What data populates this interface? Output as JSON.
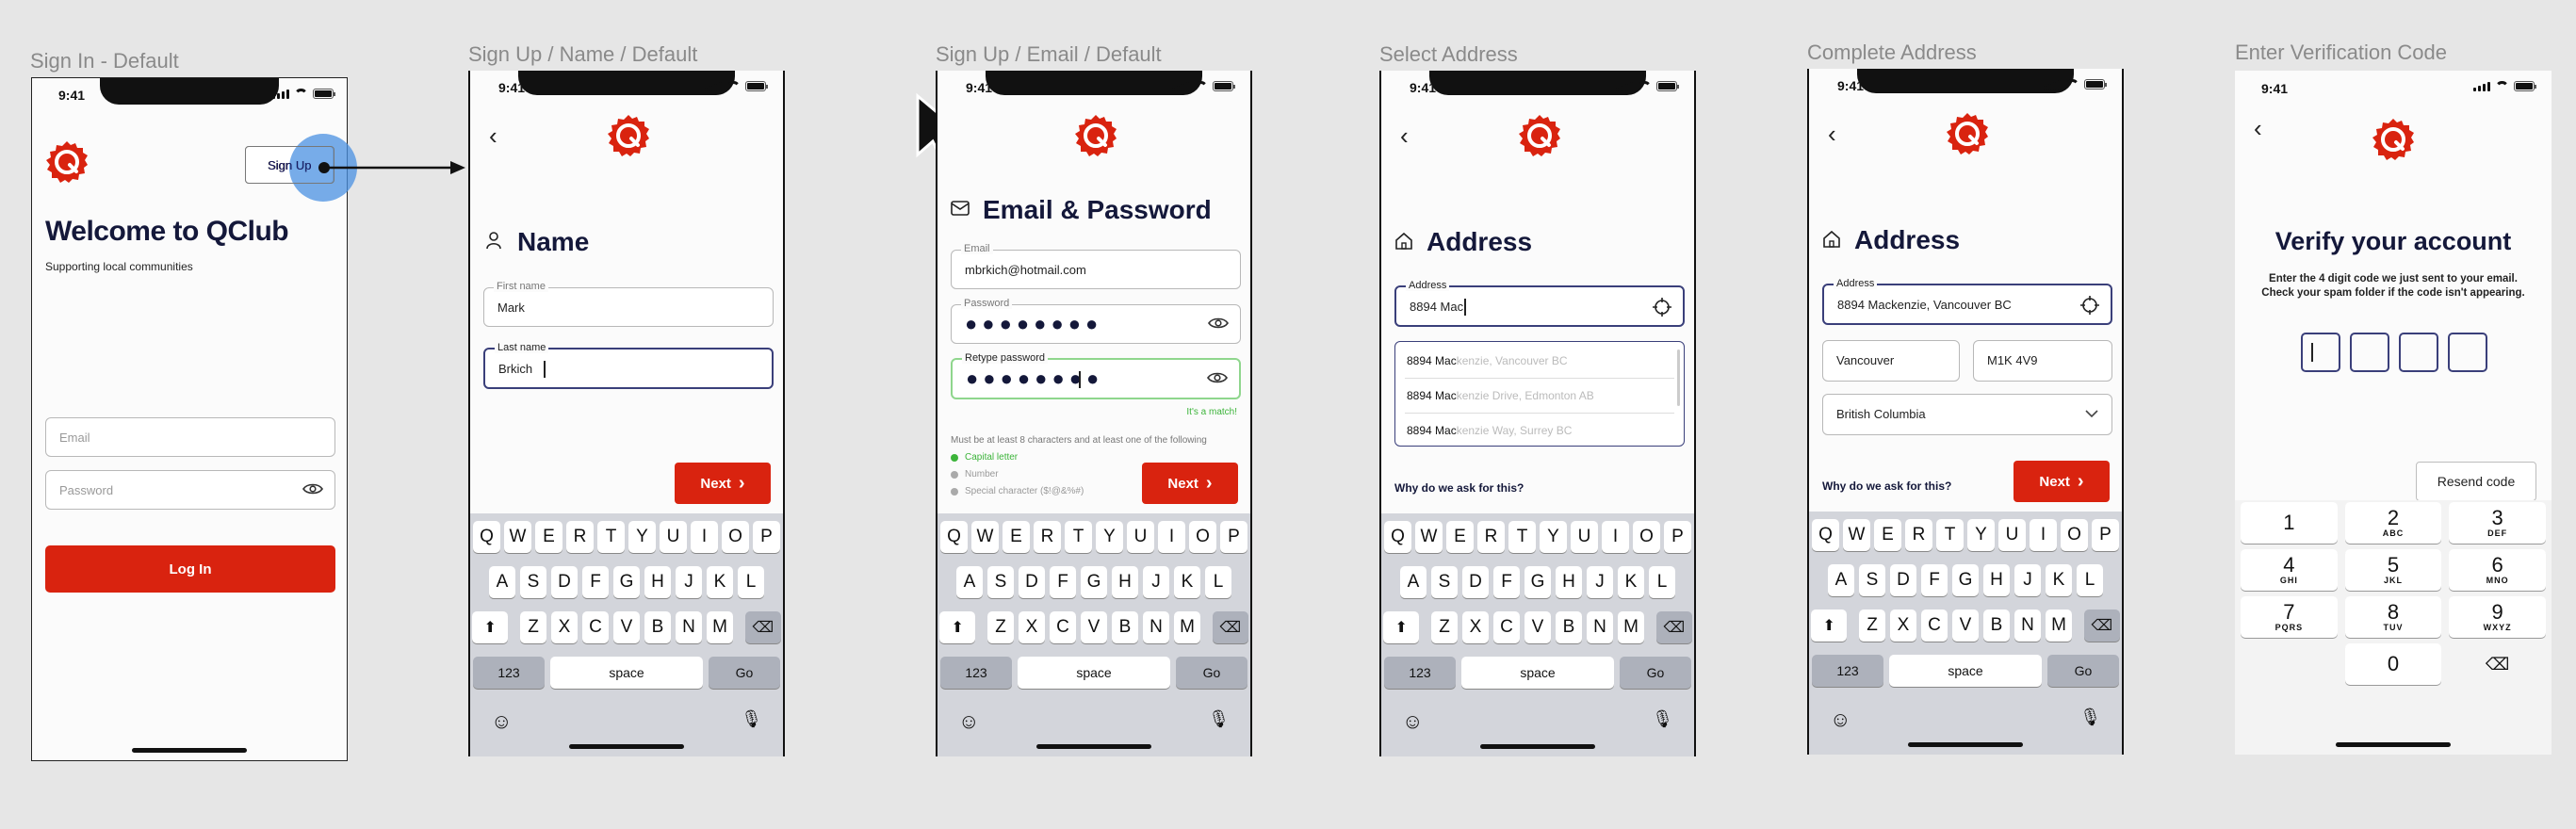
{
  "status_time": "9:41",
  "frames": {
    "f1": {
      "label": "Sign In - Default",
      "welcome": "Welcome to QClub",
      "subtitle": "Supporting local communities",
      "signup": "Sign Up",
      "email_ph": "Email",
      "password_ph": "Password",
      "login": "Log In"
    },
    "f2": {
      "label": "Sign Up / Name / Default",
      "title": "Name",
      "first_label": "First name",
      "first_value": "Mark",
      "last_label": "Last name",
      "last_value": "Brkich",
      "next": "Next"
    },
    "f3": {
      "label": "Sign Up / Email / Default",
      "title": "Email & Password",
      "email_label": "Email",
      "email_value": "mbrkich@hotmail.com",
      "password_label": "Password",
      "retype_label": "Retype password",
      "masked": "●●●●●●●●",
      "match": "It's a match!",
      "rules_intro": "Must be at least 8 characters and at least one of the following",
      "rules": [
        "Capital letter",
        "Number",
        "Special character ($!@&%#)"
      ],
      "next": "Next"
    },
    "f4": {
      "label": "Select Address",
      "title": "Address",
      "address_label": "Address",
      "address_value": "8894 Mac",
      "suggestions": [
        {
          "typed": "8894 Mac",
          "rest": "kenzie, Vancouver BC"
        },
        {
          "typed": "8894 Mac",
          "rest": "kenzie Drive, Edmonton AB"
        },
        {
          "typed": "8894 Mac",
          "rest": "kenzie Way, Surrey BC"
        }
      ],
      "why": "Why do we ask for this?"
    },
    "f5": {
      "label": "Complete Address",
      "title": "Address",
      "address_label": "Address",
      "address_value": "8894 Mackenzie, Vancouver BC",
      "city": "Vancouver",
      "postal": "M1K 4V9",
      "province": "British Columbia",
      "why": "Why do we ask for this?",
      "next": "Next"
    },
    "f6": {
      "label": "Enter Verification Code",
      "title": "Verify your account",
      "instructions": "Enter the 4 digit code we just sent to  your email. Check your spam folder if the code isn't appearing.",
      "resend": "Resend code",
      "numpad": [
        {
          "d": "1",
          "l": ""
        },
        {
          "d": "2",
          "l": "ABC"
        },
        {
          "d": "3",
          "l": "DEF"
        },
        {
          "d": "4",
          "l": "GHI"
        },
        {
          "d": "5",
          "l": "JKL"
        },
        {
          "d": "6",
          "l": "MNO"
        },
        {
          "d": "7",
          "l": "PQRS"
        },
        {
          "d": "8",
          "l": "TUV"
        },
        {
          "d": "9",
          "l": "WXYZ"
        },
        {
          "d": "",
          "l": ""
        },
        {
          "d": "0",
          "l": ""
        },
        {
          "d": "⌫",
          "l": ""
        }
      ]
    }
  },
  "keyboard": {
    "row1": [
      "Q",
      "W",
      "E",
      "R",
      "T",
      "Y",
      "U",
      "I",
      "O",
      "P"
    ],
    "row2": [
      "A",
      "S",
      "D",
      "F",
      "G",
      "H",
      "J",
      "K",
      "L"
    ],
    "row3": [
      "Z",
      "X",
      "C",
      "V",
      "B",
      "N",
      "M"
    ],
    "num": "123",
    "space": "space",
    "go": "Go"
  },
  "colors": {
    "brand_red": "#d9230f",
    "navy": "#14183a",
    "success_green": "#3cb43a",
    "highlight_blue": "#4a90e2"
  },
  "icons": [
    "q-logo-icon",
    "back-chevron-icon",
    "person-icon",
    "envelope-icon",
    "home-icon",
    "eye-icon",
    "crosshair-icon",
    "chevron-down-icon",
    "chevron-right-icon",
    "shift-icon",
    "backspace-icon",
    "emoji-icon",
    "microphone-icon",
    "cursor-arrow-icon"
  ]
}
